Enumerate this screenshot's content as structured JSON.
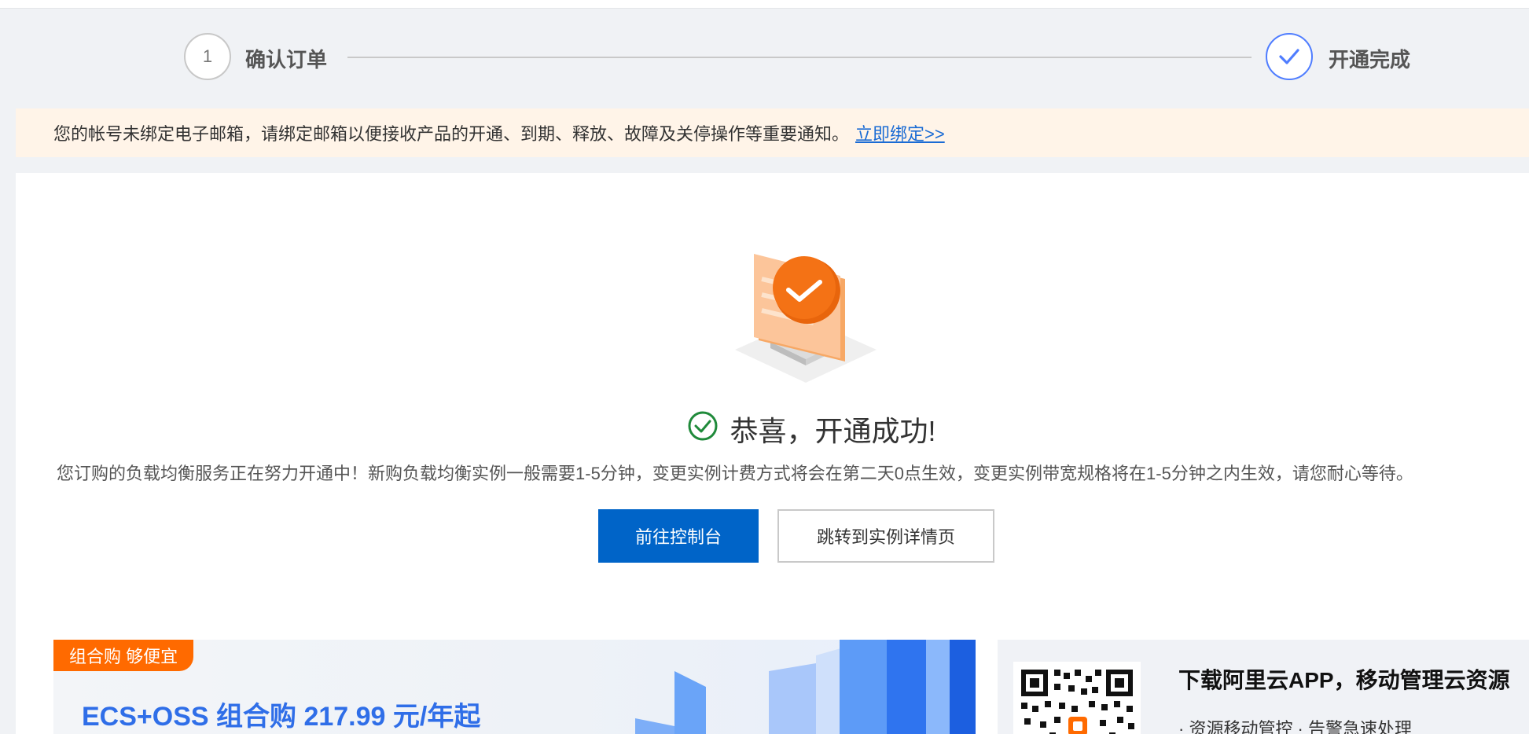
{
  "steps": {
    "step1": {
      "number": "1",
      "label": "确认订单"
    },
    "step2": {
      "label": "开通完成"
    }
  },
  "notice": {
    "text": "您的帐号未绑定电子邮箱，请绑定邮箱以便接收产品的开通、到期、释放、故障及关停操作等重要通知。",
    "link": "立即绑定>>"
  },
  "result": {
    "title": "恭喜，开通成功!",
    "description": "您订购的负载均衡服务正在努力开通中！新购负载均衡实例一般需要1-5分钟，变更实例计费方式将会在第二天0点生效，变更实例带宽规格将在1-5分钟之内生效，请您耐心等待。",
    "primary_button": "前往控制台",
    "secondary_button": "跳转到实例详情页"
  },
  "banner": {
    "tag": "组合购 够便宜",
    "title": "ECS+OSS 组合购 217.99 元/年起"
  },
  "app_promo": {
    "title": "下载阿里云APP，移动管理云资源",
    "items": "· 资源移动管控   · 告警急速处理"
  },
  "colors": {
    "primary": "#0064c8",
    "accent_orange": "#ff6a00",
    "success_green": "#1f8a3a",
    "step_blue": "#4f7dff",
    "link_blue": "#1a6bd4"
  }
}
